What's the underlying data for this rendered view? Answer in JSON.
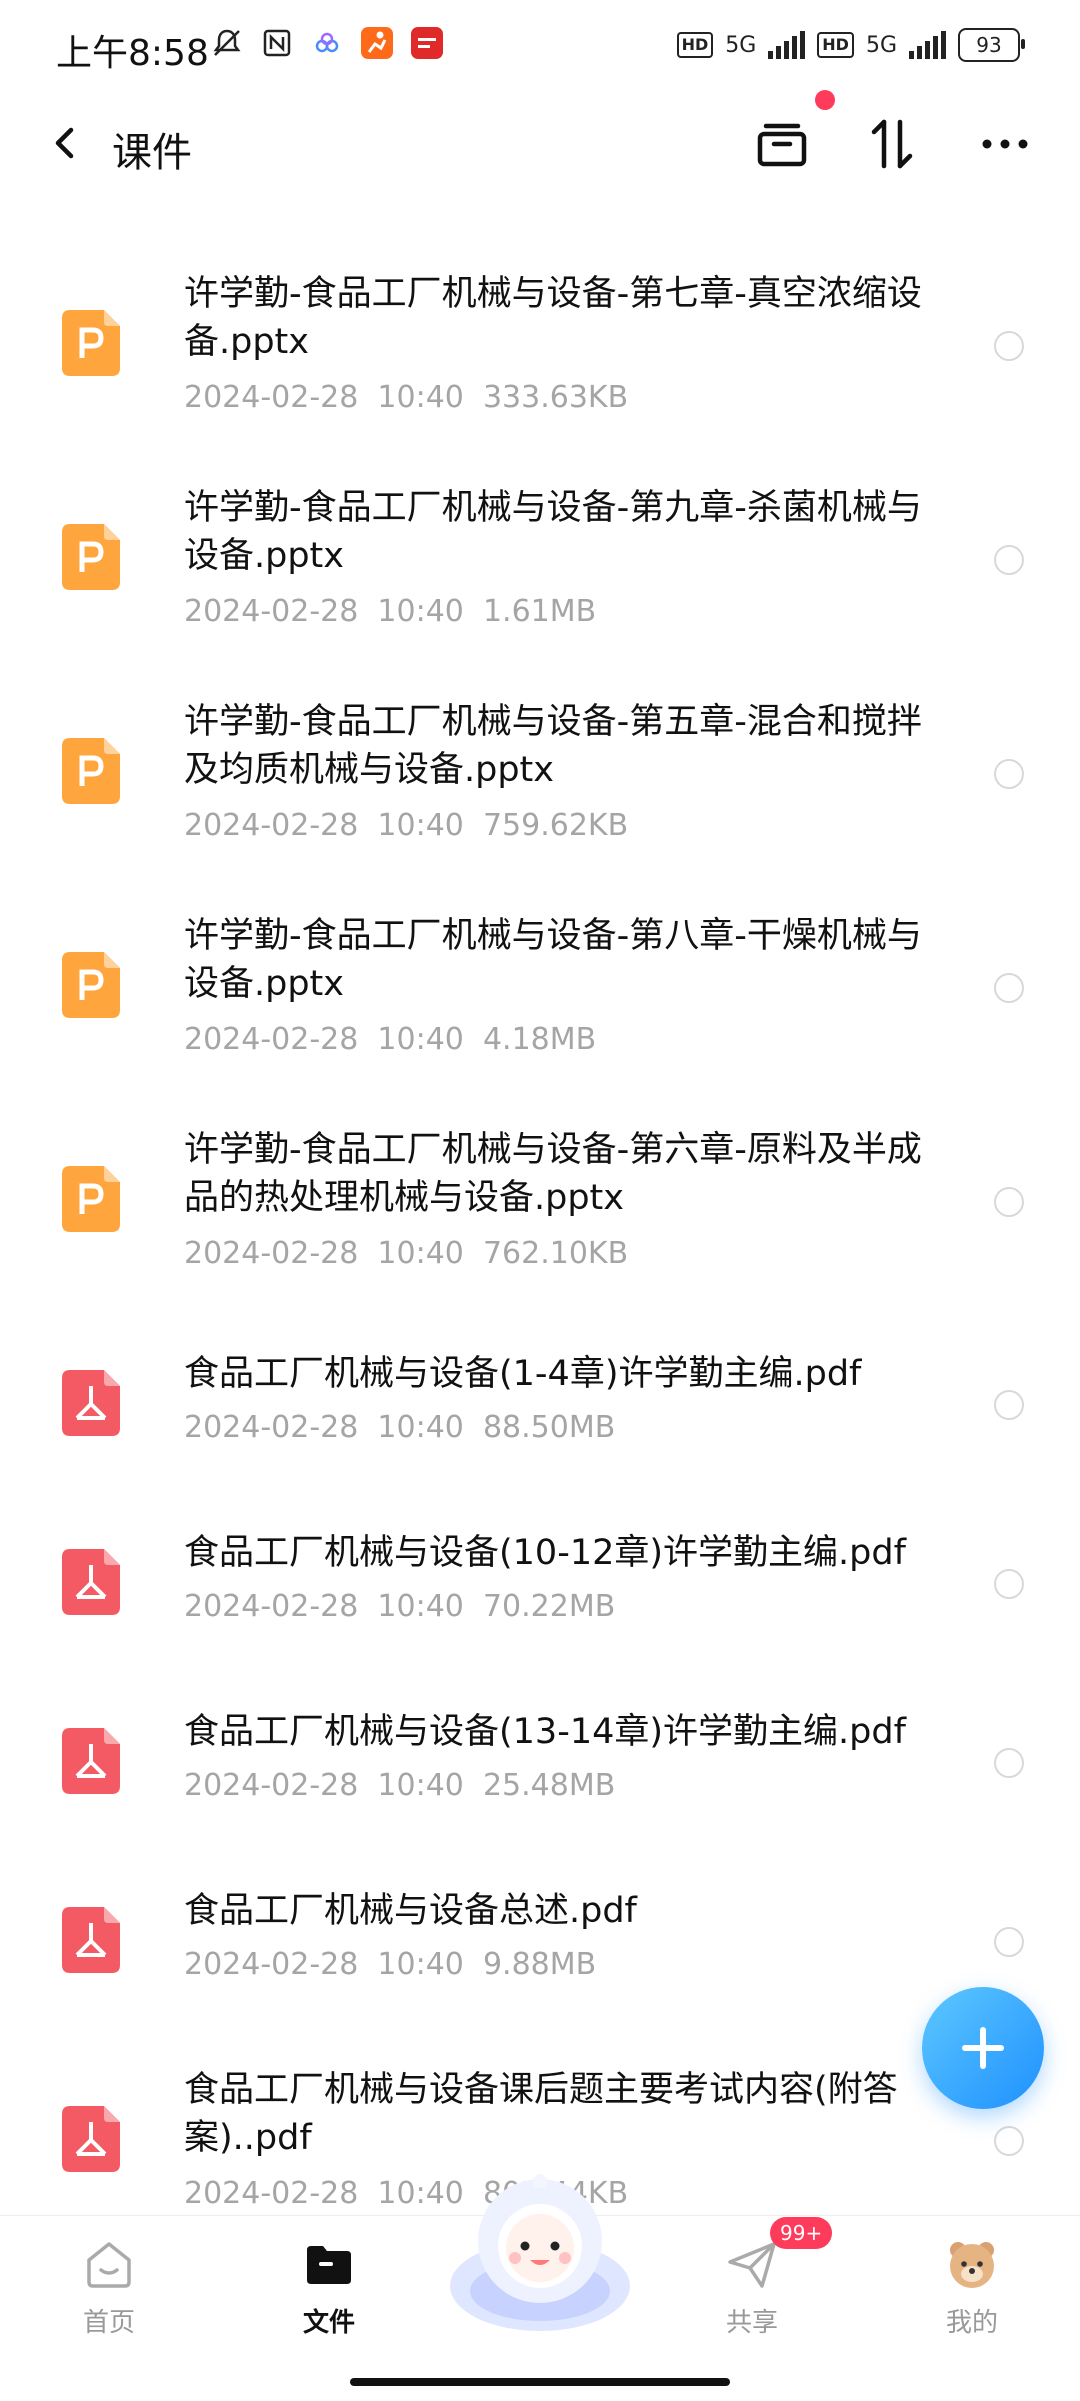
{
  "status_bar": {
    "time": "上午8:58",
    "network1": "5G",
    "network2": "5G",
    "hd1": "HD",
    "hd2": "HD",
    "battery": "93"
  },
  "header": {
    "title": "课件"
  },
  "files": [
    {
      "name": "许学勤-食品工厂机械与设备-第七章-真空浓缩设备.pptx",
      "date": "2024-02-28  10:40",
      "size": "333.63KB",
      "type": "pptx"
    },
    {
      "name": "许学勤-食品工厂机械与设备-第九章-杀菌机械与设备.pptx",
      "date": "2024-02-28  10:40",
      "size": "1.61MB",
      "type": "pptx"
    },
    {
      "name": "许学勤-食品工厂机械与设备-第五章-混合和搅拌及均质机械与设备.pptx",
      "date": "2024-02-28  10:40",
      "size": "759.62KB",
      "type": "pptx"
    },
    {
      "name": "许学勤-食品工厂机械与设备-第八章-干燥机械与设备.pptx",
      "date": "2024-02-28  10:40",
      "size": "4.18MB",
      "type": "pptx"
    },
    {
      "name": "许学勤-食品工厂机械与设备-第六章-原料及半成品的热处理机械与设备.pptx",
      "date": "2024-02-28  10:40",
      "size": "762.10KB",
      "type": "pptx"
    },
    {
      "name": "食品工厂机械与设备(1-4章)许学勤主编.pdf",
      "date": "2024-02-28  10:40",
      "size": "88.50MB",
      "type": "pdf"
    },
    {
      "name": "食品工厂机械与设备(10-12章)许学勤主编.pdf",
      "date": "2024-02-28  10:40",
      "size": "70.22MB",
      "type": "pdf"
    },
    {
      "name": "食品工厂机械与设备(13-14章)许学勤主编.pdf",
      "date": "2024-02-28  10:40",
      "size": "25.48MB",
      "type": "pdf"
    },
    {
      "name": "食品工厂机械与设备总述.pdf",
      "date": "2024-02-28  10:40",
      "size": "9.88MB",
      "type": "pdf"
    },
    {
      "name": "食品工厂机械与设备课后题主要考试内容(附答案)..pdf",
      "date": "2024-02-28  10:40",
      "size": "807.44KB",
      "type": "pdf"
    }
  ],
  "bottom_nav": {
    "home": "首页",
    "files": "文件",
    "share": "共享",
    "mine": "我的",
    "share_badge": "99+"
  },
  "icons": {
    "pptx_color": "#ffa53d",
    "pdf_color": "#f35a64",
    "fab_color": "#1e90ff"
  }
}
